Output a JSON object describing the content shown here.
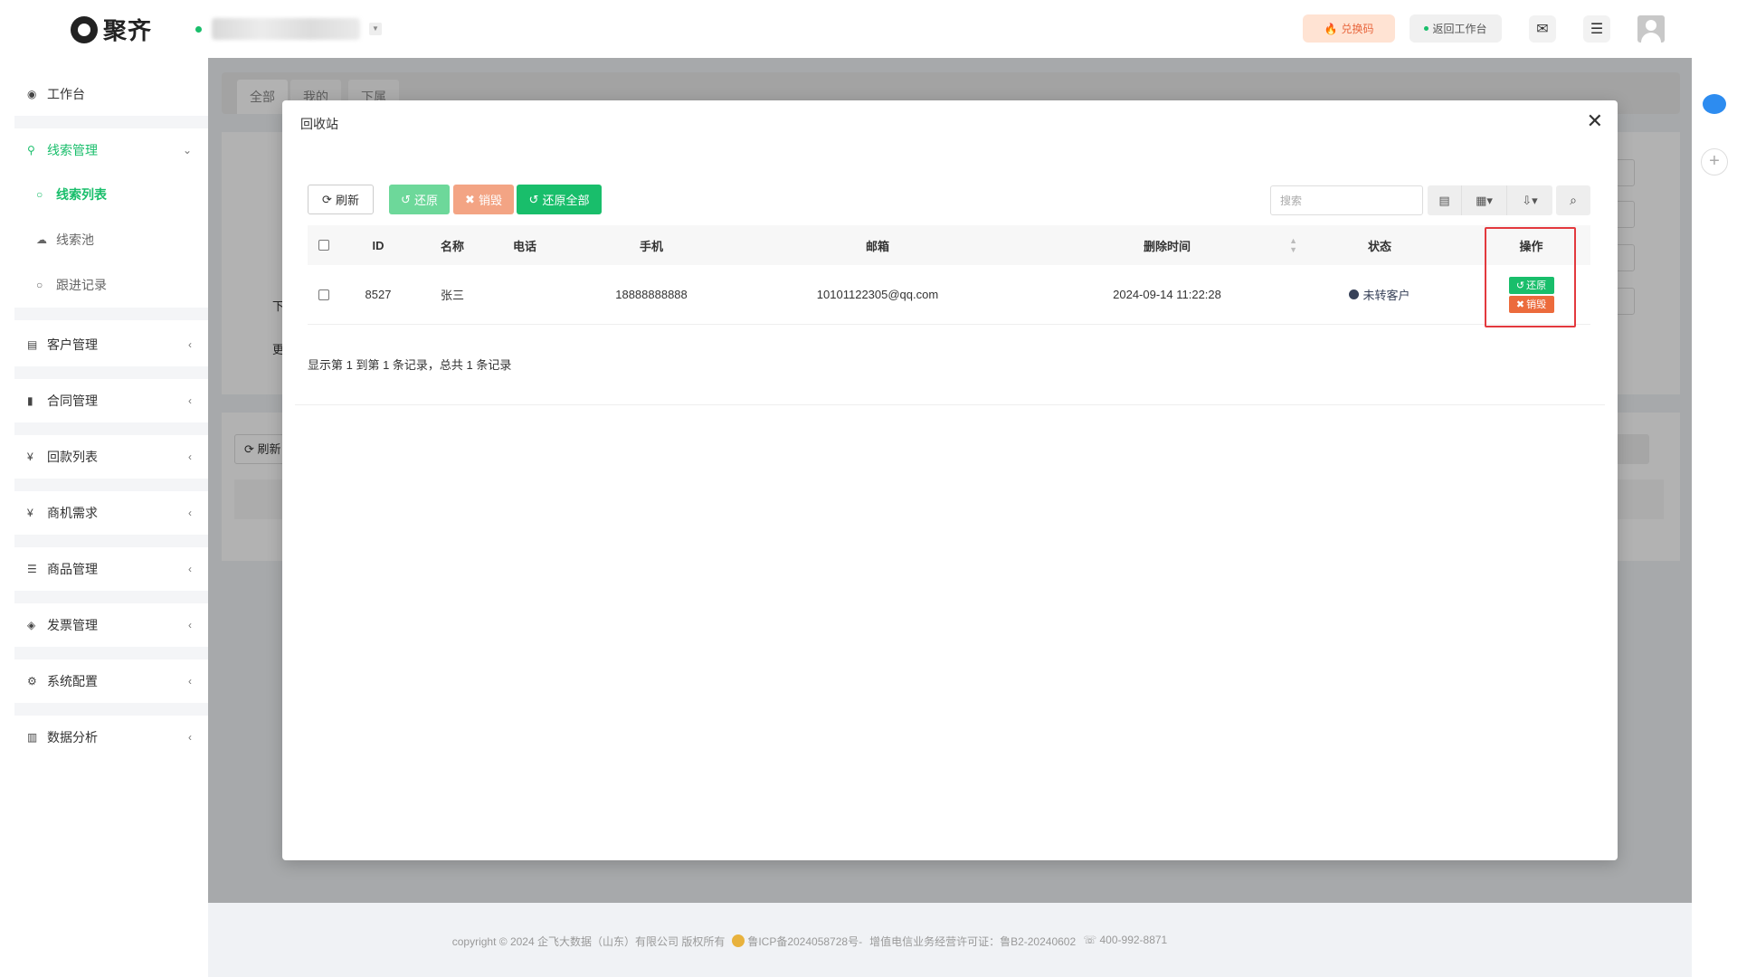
{
  "header": {
    "brand": "聚齐",
    "redeem_label": "兑换码",
    "back_label": "返回工作台"
  },
  "sidebar": {
    "items": [
      {
        "label": "工作台"
      },
      {
        "label": "线索管理"
      },
      {
        "label": "客户管理"
      },
      {
        "label": "合同管理"
      },
      {
        "label": "回款列表"
      },
      {
        "label": "商机需求"
      },
      {
        "label": "商品管理"
      },
      {
        "label": "发票管理"
      },
      {
        "label": "系统配置"
      },
      {
        "label": "数据分析"
      }
    ],
    "sub_items": [
      {
        "label": "线索列表"
      },
      {
        "label": "线索池"
      },
      {
        "label": "跟进记录"
      }
    ]
  },
  "background": {
    "tabs": [
      "全部",
      "我的",
      "下属"
    ],
    "label_a": "下",
    "label_b": "更",
    "refresh_label": "刷新"
  },
  "modal": {
    "title": "回收站",
    "toolbar": {
      "refresh": "刷新",
      "restore": "还原",
      "destroy": "销毁",
      "restore_all": "还原全部",
      "search_placeholder": "搜索"
    },
    "columns": [
      "ID",
      "名称",
      "电话",
      "手机",
      "邮箱",
      "删除时间",
      "状态",
      "操作"
    ],
    "rows": [
      {
        "id": "8527",
        "name": "张三",
        "phone": "",
        "mobile": "18888888888",
        "email": "10101122305@qq.com",
        "deleted_at": "2024-09-14 11:22:28",
        "status": "未转客户",
        "actions": {
          "restore": "还原",
          "destroy": "销毁"
        }
      }
    ],
    "pager": "显示第 1 到第 1 条记录，总共 1 条记录"
  },
  "footer": {
    "copyright": "copyright © 2024 企飞大数据（山东）有限公司 版权所有",
    "icp": "鲁ICP备2024058728号-",
    "license": "增值电信业务经营许可证：鲁B2-20240602",
    "phone": "400-992-8871"
  },
  "colors": {
    "accent": "#19be6b",
    "danger": "#ec6b3c",
    "highlight": "#e3393e"
  }
}
